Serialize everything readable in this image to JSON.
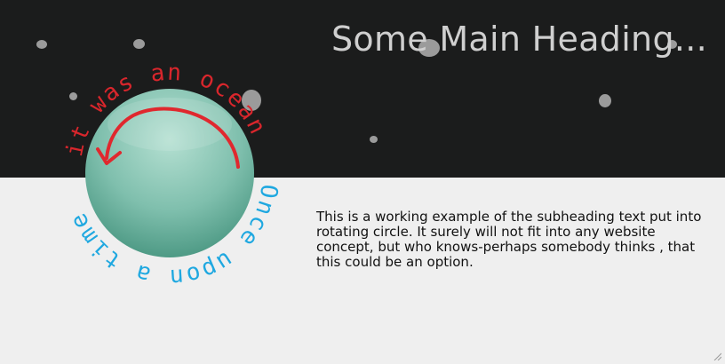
{
  "header": {
    "title": "Some Main Heading..."
  },
  "circle": {
    "text_top": "it was an ocean",
    "text_bottom": "Once upon a time",
    "colors": {
      "text_top": "#d9262c",
      "text_bottom": "#1fa8e0",
      "arrow": "#e0282e",
      "sphere_light": "#a6d6c6",
      "sphere_dark": "#4e9a85"
    }
  },
  "content": {
    "paragraph": "This is a working example of the subheading text put into rotating circle. It surely will not fit into any website concept, but who knows-perhaps somebody thinks , that this could be an option."
  },
  "colors": {
    "header_background": "#1b1c1c",
    "body_background": "#efefef",
    "heading_text": "#cfcfcf",
    "bubble": "#9b9b9b"
  }
}
